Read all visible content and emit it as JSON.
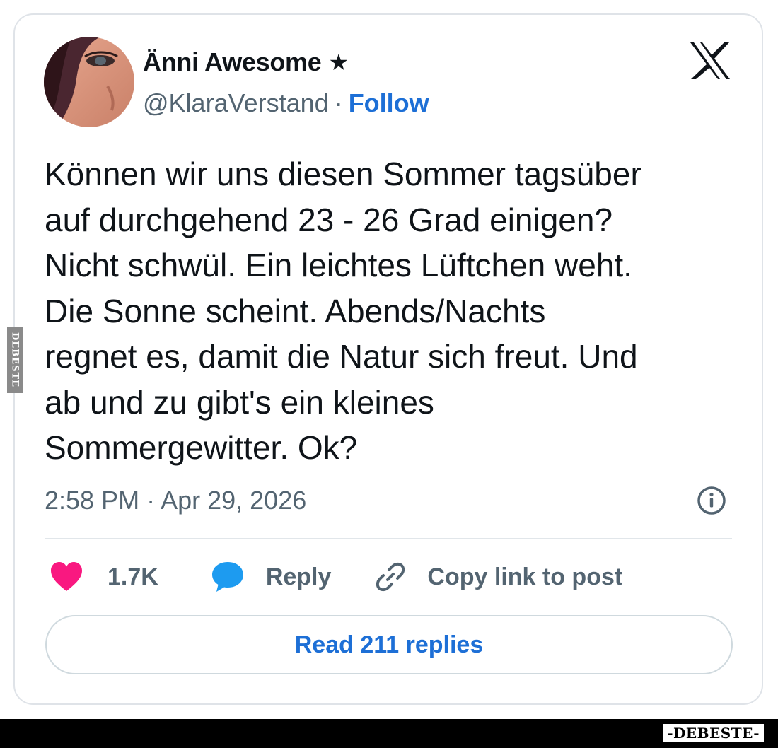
{
  "author": {
    "display_name": "Änni Awesome",
    "badge_icon": "star-icon",
    "handle": "@KlaraVerstand",
    "separator": "·",
    "follow_label": "Follow"
  },
  "platform_icon": "x-logo-icon",
  "tweet": {
    "text": "Können wir uns diesen Sommer tagsüber\nauf durchgehend 23 - 26 Grad einigen?\nNicht schwül. Ein leichtes Lüftchen weht.\nDie Sonne scheint. Abends/Nachts\nregnet es, damit die Natur sich freut. Und\nab und zu gibt's ein kleines\nSommergewitter. Ok?",
    "timestamp": "2:58 PM · Apr 29, 2026"
  },
  "actions": {
    "like_count": "1.7K",
    "reply_label": "Reply",
    "copy_link_label": "Copy link to post"
  },
  "read_replies_label": "Read 211 replies",
  "watermark": {
    "side": "DEBESTE",
    "footer": "-DEBESTE-"
  },
  "colors": {
    "accent": "#1d6fd6",
    "like": "#f91880",
    "reply": "#1d9bf0",
    "muted": "#536471"
  }
}
